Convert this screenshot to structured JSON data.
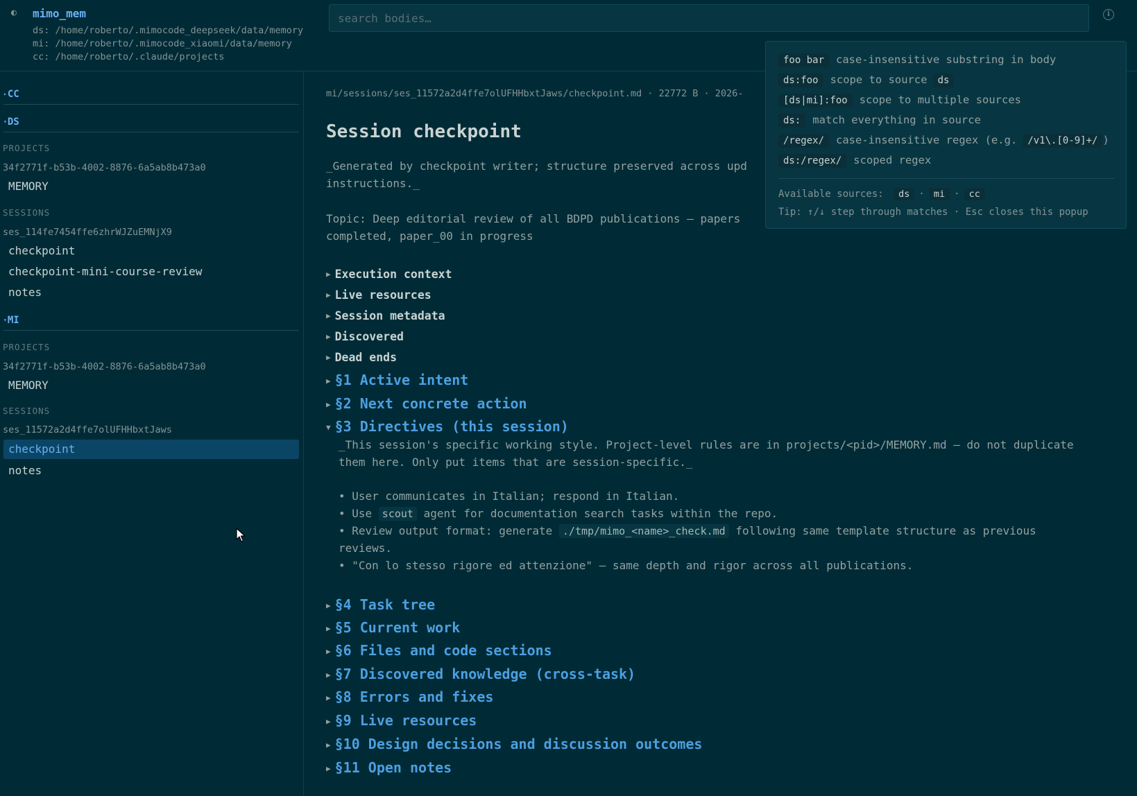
{
  "header": {
    "app_title": "mimo_mem",
    "source_paths": [
      "ds: /home/roberto/.mimocode_deepseek/data/memory",
      "mi: /home/roberto/.mimocode_xiaomi/data/memory",
      "cc: /home/roberto/.claude/projects"
    ],
    "search_placeholder": "search bodies…"
  },
  "sidebar": {
    "groups": {
      "cc": {
        "label": "CC"
      },
      "ds": {
        "label": "DS",
        "projects_label": "PROJECTS",
        "project_id": "34f2771f-b53b-4002-8876-6a5ab8b473a0",
        "project_items": [
          "MEMORY"
        ],
        "sessions_label": "SESSIONS",
        "session_id": "ses_114fe7454ffe6zhrWJZuEMNjX9",
        "session_items": [
          "checkpoint",
          "checkpoint-mini-course-review",
          "notes"
        ]
      },
      "mi": {
        "label": "MI",
        "projects_label": "PROJECTS",
        "project_id": "34f2771f-b53b-4002-8876-6a5ab8b473a0",
        "project_items": [
          "MEMORY"
        ],
        "sessions_label": "SESSIONS",
        "session_id": "ses_11572a2d4ffe7olUFHHbxtJaws",
        "session_items": [
          "checkpoint",
          "notes"
        ],
        "active_item": "checkpoint"
      }
    }
  },
  "main": {
    "file_meta": "mi/sessions/ses_11572a2d4ffe7olUFHHbxtJaws/checkpoint.md · 22772 B · 2026-",
    "title": "Session checkpoint",
    "intro": "_Generated by checkpoint writer; structure preserved across upd\ninstructions._",
    "topic": "Topic: Deep editorial review of all BDPD publications — papers\ncompleted, paper_00 in progress",
    "details": [
      "Execution context",
      "Live resources",
      "Session metadata",
      "Discovered",
      "Dead ends"
    ],
    "sections": {
      "s1": "§1 Active intent",
      "s2": "§2 Next concrete action",
      "s3": "§3 Directives (this session)",
      "s4": "§4 Task tree",
      "s5": "§5 Current work",
      "s6": "§6 Files and code sections",
      "s7": "§7 Discovered knowledge (cross-task)",
      "s8": "§8 Errors and fixes",
      "s9": "§9 Live resources",
      "s10": "§10 Design decisions and discussion outcomes",
      "s11": "§11 Open notes"
    },
    "directives": {
      "intro_line1": "_This session's specific working style. Project-level rules are in projects/<pid>/MEMORY.md — do not duplicate",
      "intro_line2": "them here. Only put items that are session-specific._",
      "b1": "• User communicates in Italian; respond in Italian.",
      "b2_pre": "• Use ",
      "b2_code": "scout",
      "b2_post": " agent for documentation search tasks within the repo.",
      "b3_pre": "• Review output format: generate ",
      "b3_code": "./tmp/mimo_<name>_check.md",
      "b3_post": " following same template structure as previous",
      "b3_cont": "reviews.",
      "b4": "• \"Con lo stesso rigore ed attenzione\" — same depth and rigor across all publications."
    }
  },
  "popup": {
    "rows": [
      {
        "code": "foo bar",
        "desc": "case-insensitive substring in body"
      },
      {
        "code": "ds:foo",
        "desc": "scope to source",
        "extra": "ds"
      },
      {
        "code": "[ds|mi]:foo",
        "desc": "scope to multiple sources"
      },
      {
        "code": "ds:",
        "desc": "match everything in source"
      },
      {
        "code": "/regex/",
        "desc": "case-insensitive regex (e.g.",
        "extra": "/v1\\.[0-9]+/",
        "tail": ")"
      },
      {
        "code": "ds:/regex/",
        "desc": "scoped regex"
      }
    ],
    "sources_label": "Available sources:",
    "sources": [
      "ds",
      "mi",
      "cc"
    ],
    "tip": "Tip: ↑/↓ step through matches · Esc closes this popup"
  }
}
